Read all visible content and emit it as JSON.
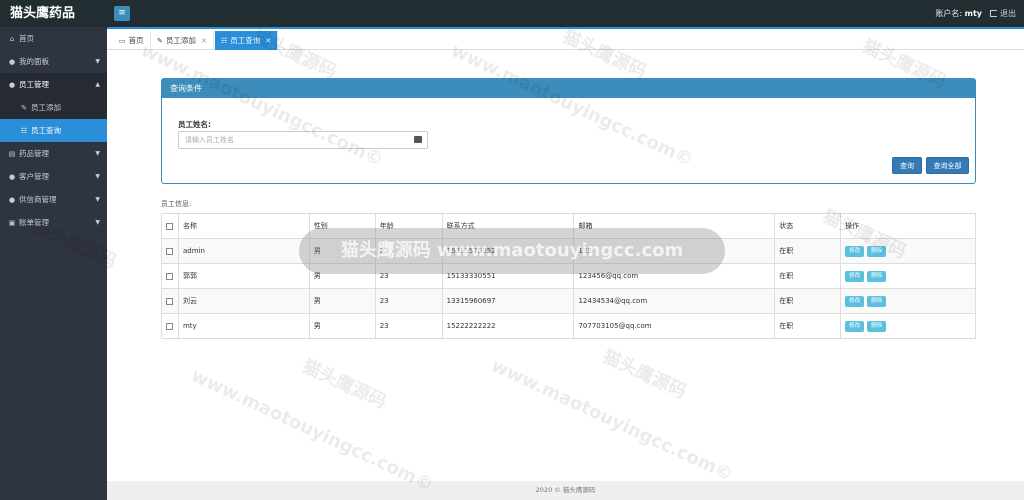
{
  "app": {
    "brand": "猫头鹰药品",
    "toggle_icon": "menu-icon",
    "account_label": "账户名:",
    "account_name": "mty",
    "logout_label": "退出"
  },
  "sidebar": {
    "items": [
      {
        "label": "首页",
        "icon": "home-icon"
      },
      {
        "label": "我的面板",
        "icon": "user-icon"
      },
      {
        "label": "员工管理",
        "icon": "users-icon"
      },
      {
        "label": "员工添加",
        "icon": "edit-icon"
      },
      {
        "label": "员工查询",
        "icon": "list-icon"
      },
      {
        "label": "药品管理",
        "icon": "book-icon"
      },
      {
        "label": "客户管理",
        "icon": "users-icon"
      },
      {
        "label": "供信商管理",
        "icon": "users-icon"
      },
      {
        "label": "账单管理",
        "icon": "folder-icon"
      }
    ]
  },
  "tabs": [
    {
      "label": "首页",
      "icon": "monitor-icon"
    },
    {
      "label": "员工添加",
      "icon": "edit-icon"
    },
    {
      "label": "员工查询",
      "icon": "list-icon"
    }
  ],
  "query_panel": {
    "title": "查询条件",
    "name_label": "员工姓名:",
    "name_placeholder": "请输入员工姓名",
    "search_button": "查询",
    "search_all_button": "查询全部"
  },
  "table": {
    "title": "员工信息:",
    "columns": [
      "名称",
      "性别",
      "年龄",
      "联系方式",
      "邮箱",
      "状态",
      "操作"
    ],
    "edit_label": "修改",
    "delete_label": "删除",
    "rows": [
      {
        "name": "admin",
        "gender": "男",
        "age": "23",
        "phone": "15252525252",
        "email": "123",
        "status": "在职"
      },
      {
        "name": "郭郭",
        "gender": "男",
        "age": "23",
        "phone": "15133330551",
        "email": "123456@qq.com",
        "status": "在职"
      },
      {
        "name": "刘云",
        "gender": "男",
        "age": "23",
        "phone": "13315960697",
        "email": "12434534@qq.com",
        "status": "在职"
      },
      {
        "name": "mty",
        "gender": "男",
        "age": "23",
        "phone": "15222222222",
        "email": "707703105@qq.com",
        "status": "在职"
      }
    ]
  },
  "footer": {
    "text": "2020 © 猫头鹰源码"
  },
  "watermark": {
    "line1": "猫头鹰源码",
    "line2": "www.maotouyingcc.com©",
    "overlay": "猫头鹰源码 www.maotouyingcc.com"
  }
}
